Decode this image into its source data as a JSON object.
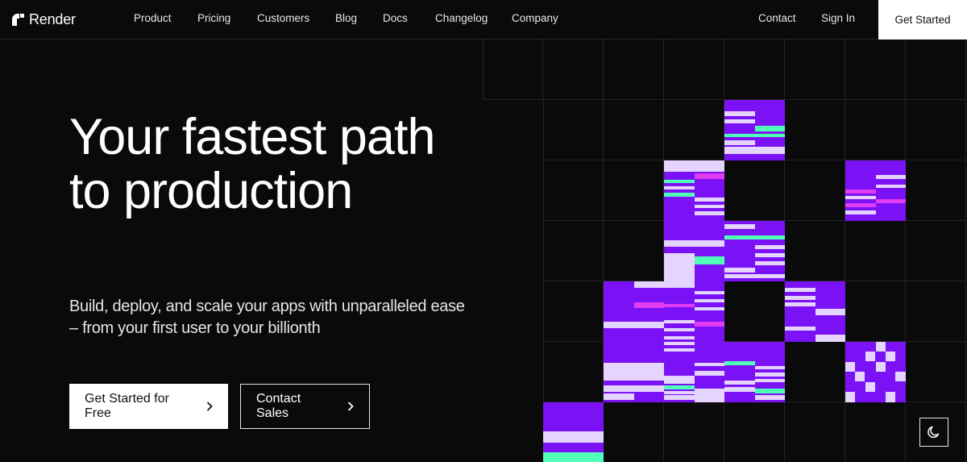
{
  "nav": {
    "brand": "Render",
    "links": [
      "Product",
      "Pricing",
      "Customers",
      "Blog",
      "Docs",
      "Changelog",
      "Company"
    ],
    "contact": "Contact",
    "sign_in": "Sign In",
    "get_started": "Get Started"
  },
  "hero": {
    "headline": "Your fastest path to production",
    "subline": "Build, deploy, and scale your apps with unparalleled ease – from your first user to your billionth",
    "primary_cta": "Get Started for Free",
    "secondary_cta": "Contact Sales"
  },
  "theme_toggle": {
    "icon": "moon-icon"
  },
  "colors": {
    "background": "#0b0a0b",
    "tile_purple": "#7b12f5",
    "tile_lavender": "#e4d4ff",
    "tile_mint": "#4fffb8",
    "tile_pink": "#e03cf2"
  }
}
